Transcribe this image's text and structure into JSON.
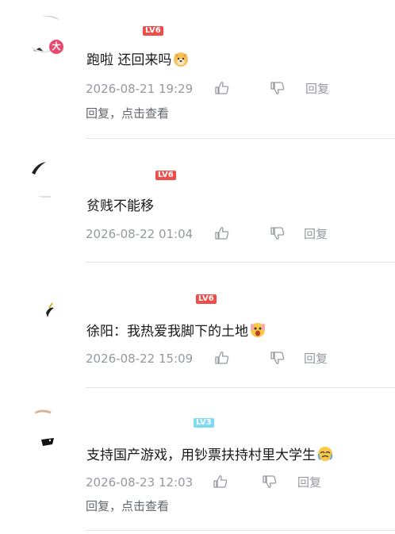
{
  "colors": {
    "text_primary": "#18191c",
    "text_secondary": "#9499a0",
    "level_red": "#f04c49",
    "level_blue": "#7ed9f5",
    "divider": "#e3e5e7"
  },
  "comments": [
    {
      "avatar_icon": "user-avatar-icon",
      "avatar_badge": "大",
      "level": "LV6",
      "text": "跑啦 还回来吗",
      "emoji_icon": "doge-emoji-icon",
      "time": "2026-08-21 19:29",
      "like_count": "",
      "reply_label": "回复",
      "sub_reply_text": "回复，点击查看"
    },
    {
      "avatar_icon": "user-avatar-icon",
      "level": "LV6",
      "text": "贫贱不能移",
      "time": "2026-08-22 01:04",
      "reply_label": "回复"
    },
    {
      "avatar_icon": "user-avatar-icon",
      "level": "LV6",
      "text": "徐阳：我热爱我脚下的土地",
      "emoji_icon": "shocked-emoji-icon",
      "time": "2026-08-22 15:09",
      "reply_label": "回复"
    },
    {
      "avatar_icon": "user-avatar-icon",
      "level": "LV3",
      "text": "支持国产游戏，用钞票扶持村里大学生",
      "emoji_icon": "crying-emoji-icon",
      "time": "2026-08-23 12:03",
      "reply_label": "回复",
      "sub_reply_text": "回复，点击查看"
    }
  ]
}
